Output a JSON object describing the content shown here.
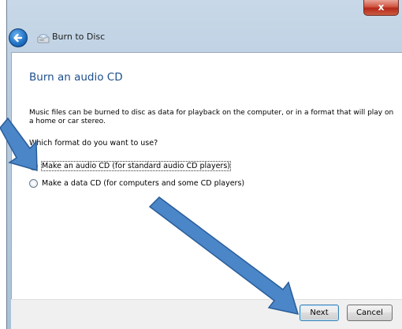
{
  "window": {
    "close_label": "x",
    "app_title": "Burn to Disc"
  },
  "icons": {
    "back": "back-arrow-icon",
    "app": "burn-disc-icon",
    "annotation": "annotation-arrow"
  },
  "content": {
    "heading": "Burn an audio CD",
    "description": "Music files can be burned to disc as data for playback on the computer, or in a format that will play on a home or car stereo.",
    "question": "Which format do you want to use?",
    "options": [
      {
        "label": "Make an audio CD (for standard audio CD players)",
        "selected": true
      },
      {
        "label": "Make a data CD (for computers and some CD players)",
        "selected": false
      }
    ]
  },
  "footer": {
    "next_label": "Next",
    "cancel_label": "Cancel"
  },
  "colors": {
    "heading": "#1e4f8e",
    "annotation_arrow": "#4a86c8",
    "annotation_stroke": "#2a5d98"
  }
}
